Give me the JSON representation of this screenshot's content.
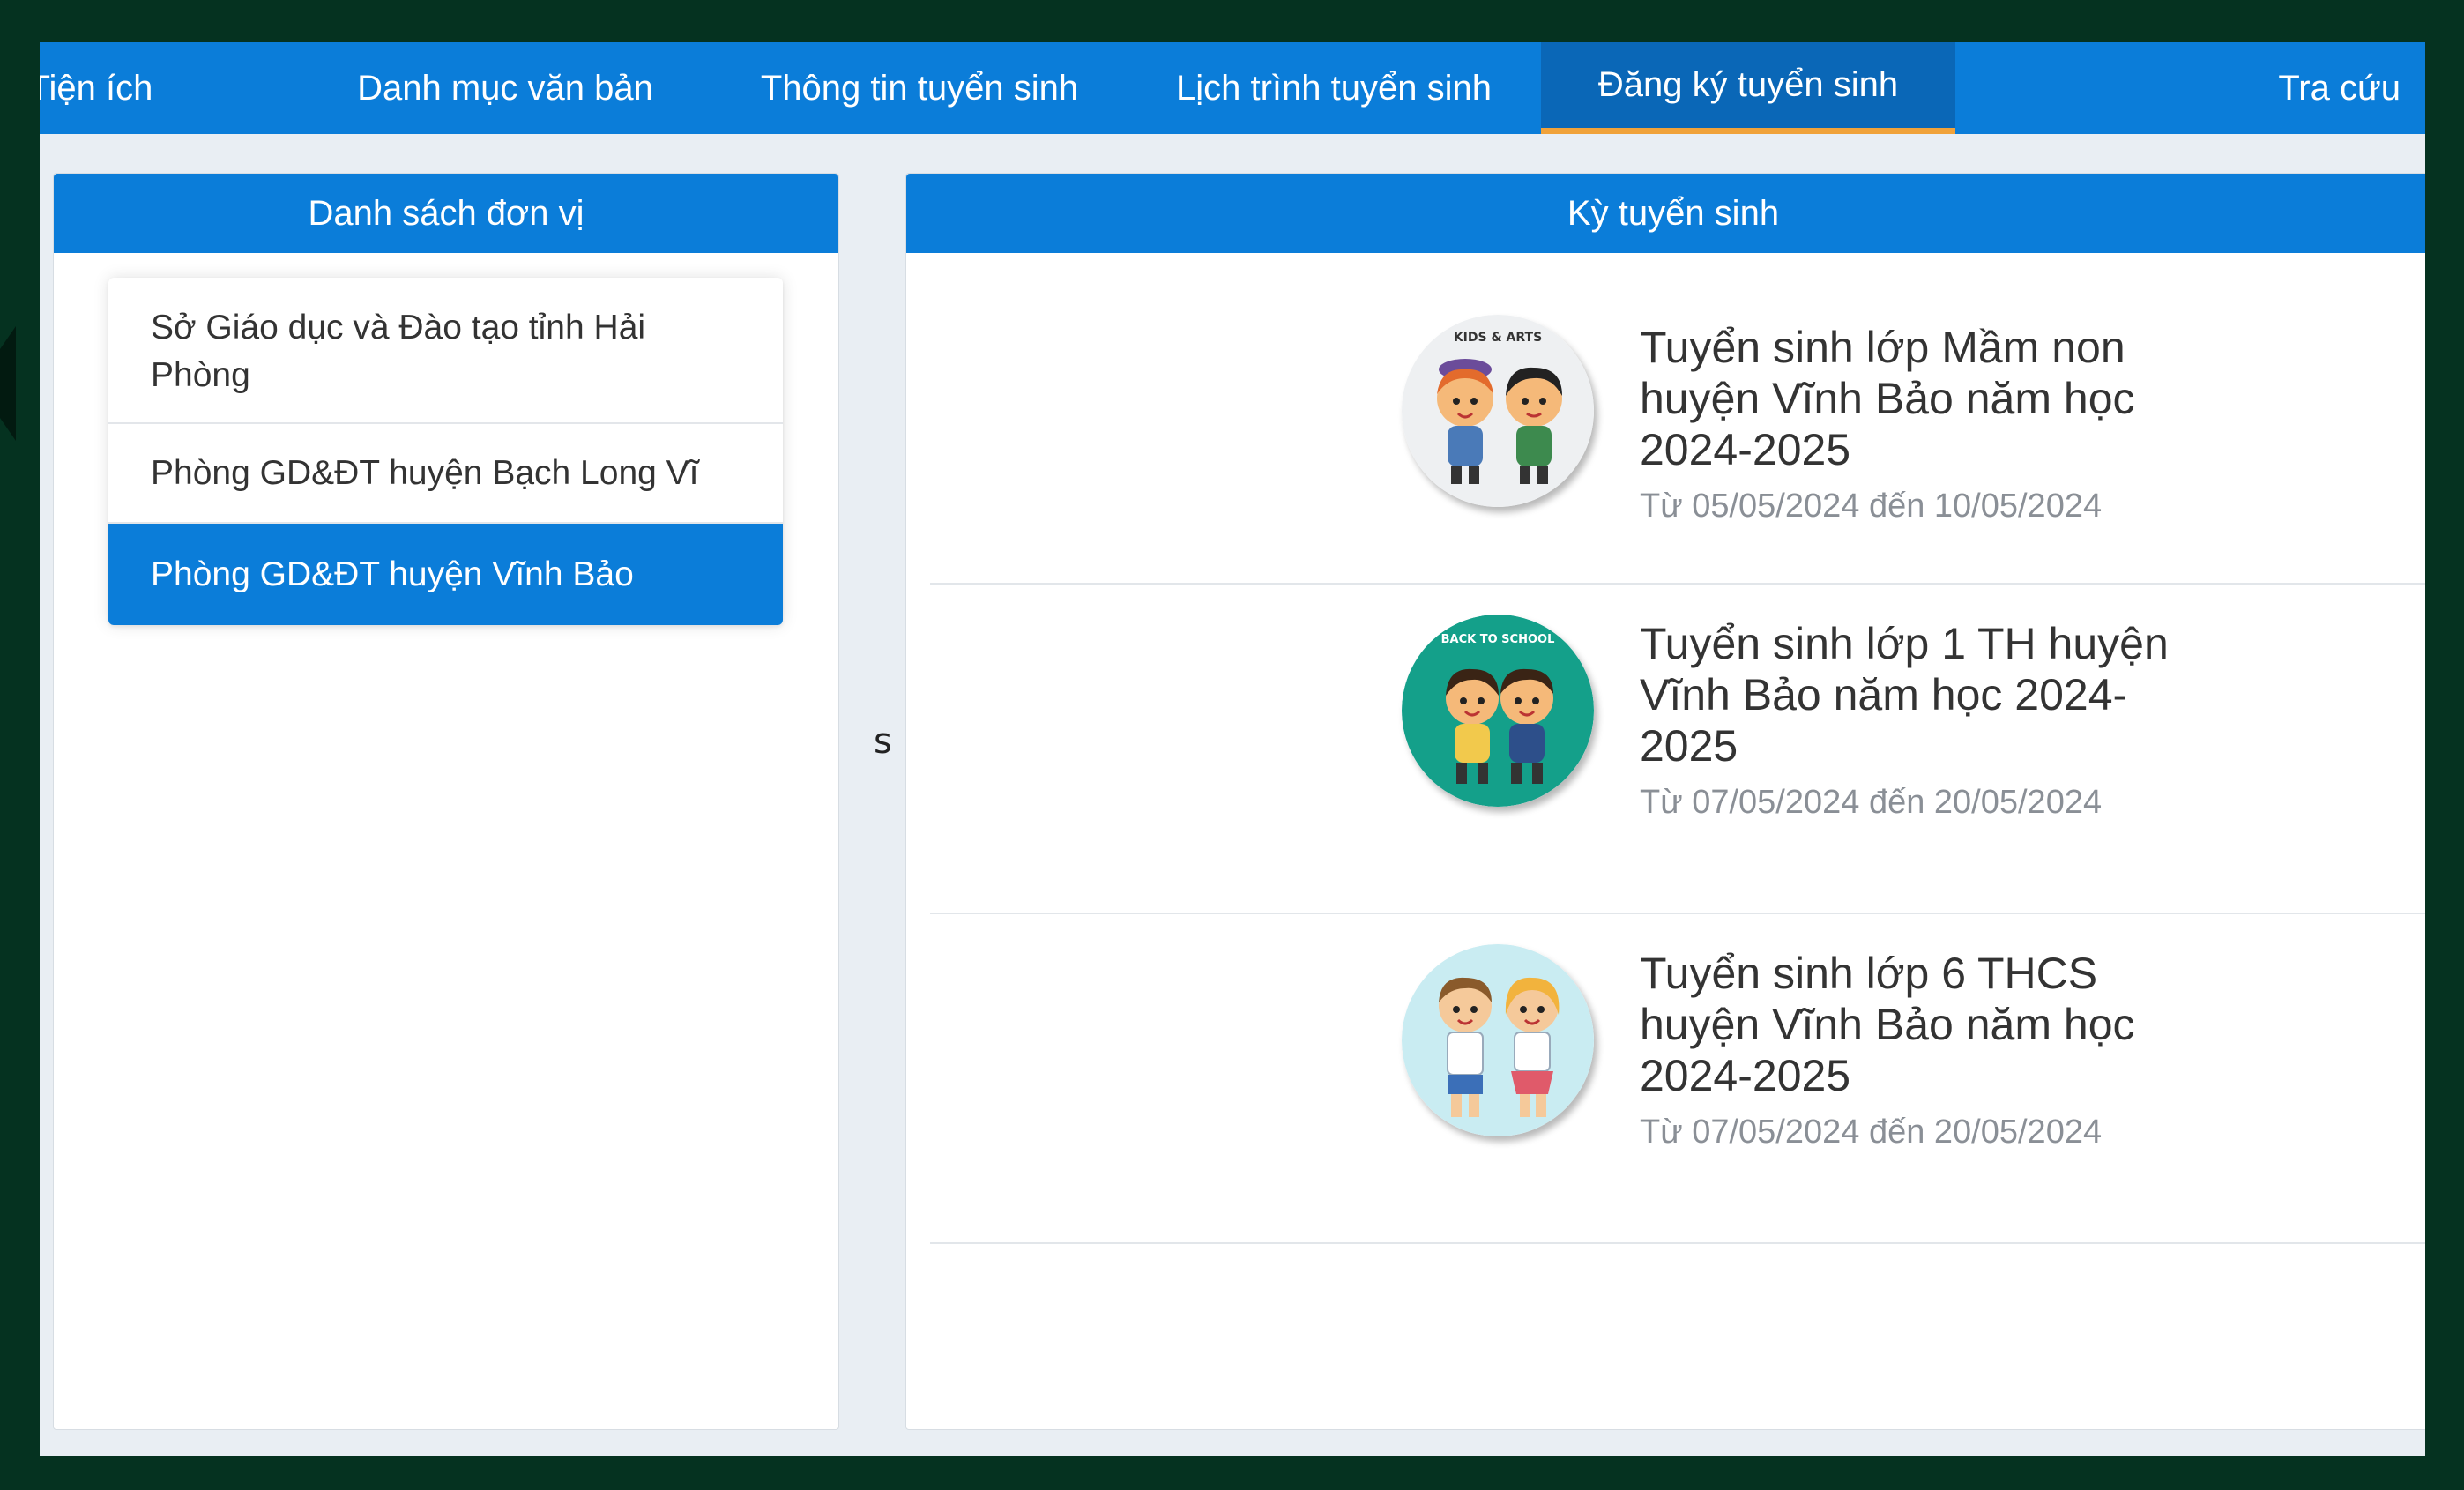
{
  "nav": {
    "items": [
      {
        "label": "Tiện ích"
      },
      {
        "label": "Danh mục văn bản"
      },
      {
        "label": "Thông tin tuyển sinh"
      },
      {
        "label": "Lịch trình tuyển sinh"
      },
      {
        "label": "Đăng ký tuyển sinh",
        "active": true
      },
      {
        "label": "Tra cứu"
      }
    ]
  },
  "left": {
    "header": "Danh sách đơn vị",
    "units": [
      {
        "label": "Sở Giáo dục và Đào tạo tỉnh Hải Phòng"
      },
      {
        "label": "Phòng GD&ĐT huyện Bạch Long Vĩ"
      },
      {
        "label": "Phòng GD&ĐT huyện Vĩnh Bảo",
        "selected": true
      }
    ]
  },
  "stray_text": "s",
  "right": {
    "header": "Kỳ tuyển sinh",
    "terms": [
      {
        "title": "Tuyển sinh lớp Mầm non huyện Vĩnh Bảo năm học 2024-2025",
        "date": "Từ 05/05/2024 đến 10/05/2024",
        "icon": "kids-arts-icon",
        "icon_text": "KIDS & ARTS"
      },
      {
        "title": "Tuyển sinh lớp 1 TH huyện Vĩnh Bảo năm học 2024-2025",
        "date": "Từ 07/05/2024 đến 20/05/2024",
        "icon": "back-to-school-icon",
        "icon_text": "BACK TO SCHOOL"
      },
      {
        "title": "Tuyển sinh lớp 6 THCS huyện Vĩnh Bảo năm học 2024-2025",
        "date": "Từ 07/05/2024 đến 20/05/2024",
        "icon": "students-icon",
        "icon_text": ""
      }
    ]
  },
  "colors": {
    "primary": "#0b7dd9",
    "active_tab_underline": "#f0a23a",
    "outer_frame": "#053220"
  }
}
